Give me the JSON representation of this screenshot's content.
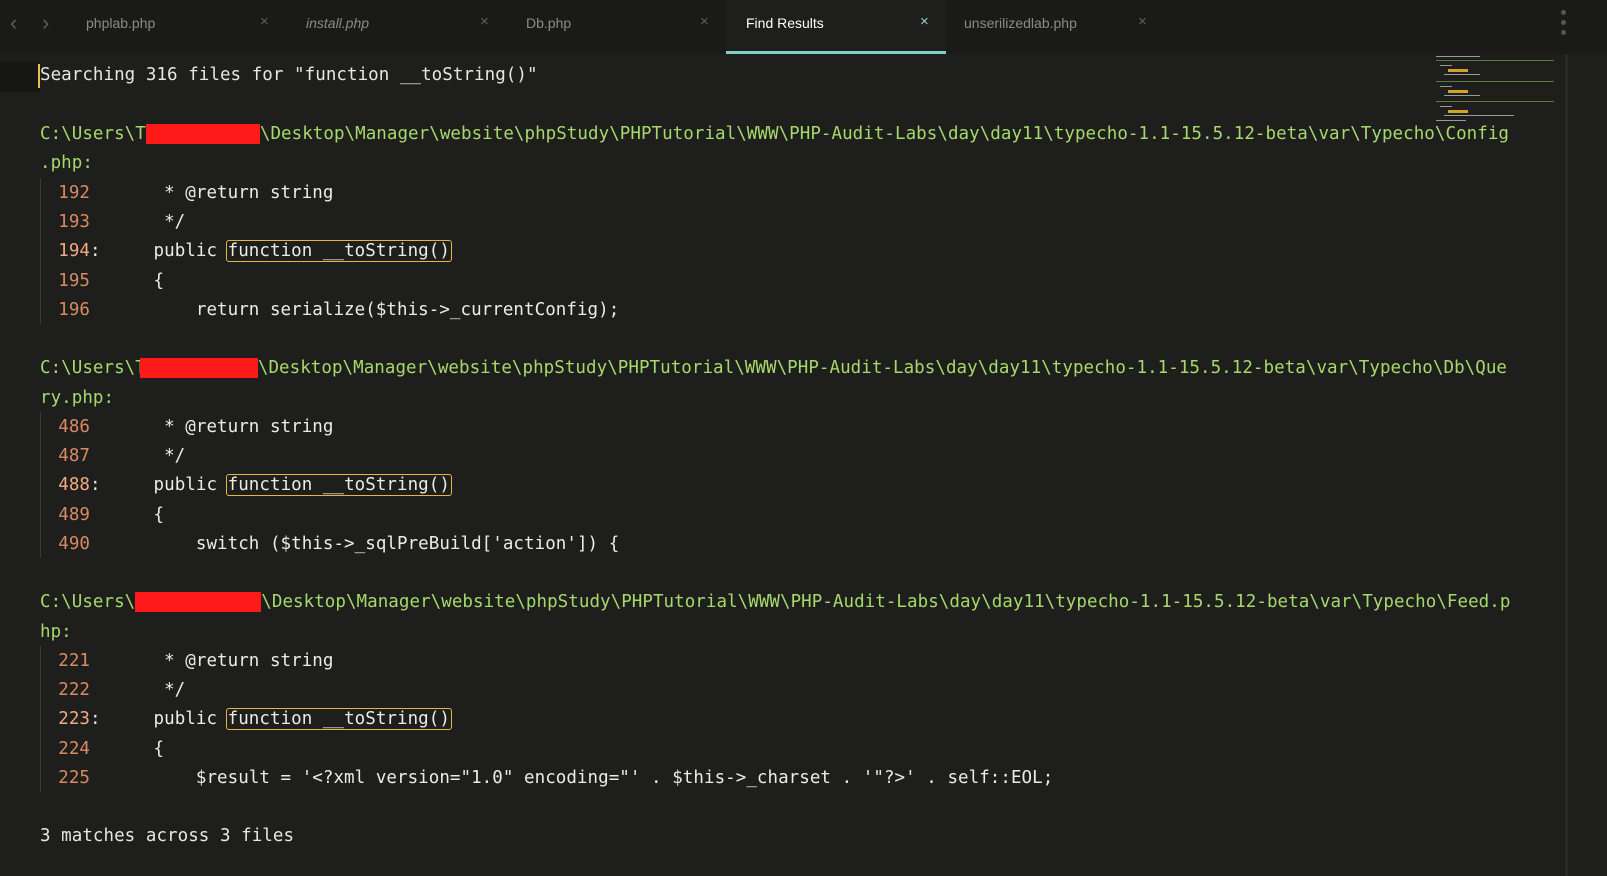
{
  "tabs": [
    {
      "label": "phplab.php",
      "close": "×"
    },
    {
      "label": "install.php",
      "close": "×"
    },
    {
      "label": "Db.php",
      "close": "×"
    },
    {
      "label": "Find Results",
      "close": "×"
    },
    {
      "label": "unserilizedlab.php",
      "close": "×"
    }
  ],
  "nav": {
    "back": "‹",
    "forward": "›"
  },
  "search": {
    "header": "Searching 316 files for \"function __toString()\""
  },
  "results": [
    {
      "path_prefix": "C:\\Users\\T",
      "path_suffix": "\\Desktop\\Manager\\website\\phpStudy\\PHPTutorial\\WWW\\PHP-Audit-Labs\\day\\day11\\typecho-1.1-15.5.12-beta\\var\\Typecho\\Config",
      "path_wrap": ".php:",
      "lines": [
        {
          "num": "192",
          "text": "     * @return string"
        },
        {
          "num": "193",
          "text": "     */"
        },
        {
          "num": "194",
          "text": "    public ",
          "match": "function __toString()"
        },
        {
          "num": "195",
          "text": "    {"
        },
        {
          "num": "196",
          "text": "        return serialize($this->_currentConfig);"
        }
      ]
    },
    {
      "path_prefix": "C:\\Users\\T",
      "path_suffix": "\\Desktop\\Manager\\website\\phpStudy\\PHPTutorial\\WWW\\PHP-Audit-Labs\\day\\day11\\typecho-1.1-15.5.12-beta\\var\\Typecho\\Db\\Que",
      "path_wrap": "ry.php:",
      "lines": [
        {
          "num": "486",
          "text": "     * @return string"
        },
        {
          "num": "487",
          "text": "     */"
        },
        {
          "num": "488",
          "text": "    public ",
          "match": "function __toString()"
        },
        {
          "num": "489",
          "text": "    {"
        },
        {
          "num": "490",
          "text": "        switch ($this->_sqlPreBuild['action']) {"
        }
      ]
    },
    {
      "path_prefix": "C:\\Users\\",
      "path_suffix": "\\Desktop\\Manager\\website\\phpStudy\\PHPTutorial\\WWW\\PHP-Audit-Labs\\day\\day11\\typecho-1.1-15.5.12-beta\\var\\Typecho\\Feed.p",
      "path_wrap": "hp:",
      "lines": [
        {
          "num": "221",
          "text": "     * @return string"
        },
        {
          "num": "222",
          "text": "     */"
        },
        {
          "num": "223",
          "text": "    public ",
          "match": "function __toString()"
        },
        {
          "num": "224",
          "text": "    {"
        },
        {
          "num": "225",
          "text": "        $result = '<?xml version=\"1.0\" encoding=\"' . $this->_charset . '\"?>' . self::EOL;"
        }
      ]
    }
  ],
  "summary": "3 matches across 3 files",
  "colors": {
    "path": "#a6d96b",
    "line_number": "#d98a63",
    "match_border": "#e2b83f",
    "active_tab_accent": "#7fcfc9",
    "redaction": "#ff1a1a"
  }
}
